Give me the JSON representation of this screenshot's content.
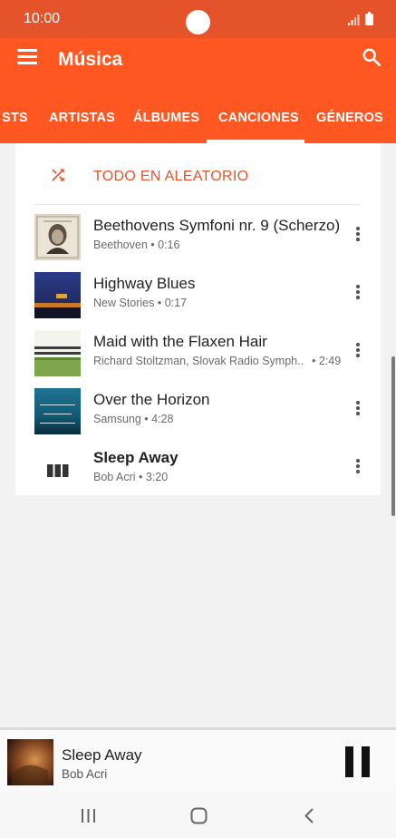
{
  "status_bar": {
    "time": "10:00"
  },
  "app_bar": {
    "title": "Música"
  },
  "tabs": [
    {
      "label": "STS"
    },
    {
      "label": "ARTISTAS"
    },
    {
      "label": "ÁLBUMES"
    },
    {
      "label": "CANCIONES",
      "selected": true
    },
    {
      "label": "GÉNEROS"
    }
  ],
  "shuffle": {
    "label": "TODO EN ALEATORIO"
  },
  "songs": [
    {
      "title": "Beethovens Symfoni nr. 9 (Scherzo)",
      "subtitle": "Beethoven • 0:16",
      "art": "beethoven-cover"
    },
    {
      "title": "Highway Blues",
      "subtitle": "New Stories • 0:17",
      "art": "highway-cover"
    },
    {
      "title": "Maid with the Flaxen Hair",
      "subtitle": "Richard Stoltzman, Slovak Radio Symph..",
      "duration": "• 2:49",
      "art": "stoltzman-cover"
    },
    {
      "title": "Over the Horizon",
      "subtitle": "Samsung • 4:28",
      "art": "horizon-cover"
    },
    {
      "title": "Sleep Away",
      "subtitle": "Bob Acri • 3:20",
      "art": "now-playing-bars-icon",
      "playing": true
    }
  ],
  "now_playing": {
    "title": "Sleep Away",
    "artist": "Bob Acri"
  },
  "colors": {
    "accent": "#ff5722",
    "status_bar": "#e5532a"
  }
}
